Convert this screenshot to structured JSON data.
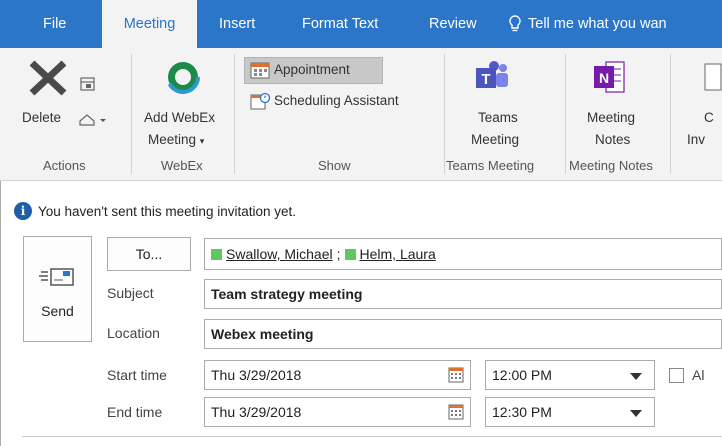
{
  "tabs": {
    "file": "File",
    "meeting": "Meeting",
    "insert": "Insert",
    "format_text": "Format Text",
    "review": "Review",
    "tell_me": "Tell me what you wan"
  },
  "ribbon": {
    "actions": {
      "delete_label": "Delete",
      "group_label": "Actions"
    },
    "webex": {
      "add_webex_line1": "Add WebEx",
      "add_webex_line2": "Meeting",
      "group_label": "WebEx"
    },
    "show": {
      "appointment": "Appointment",
      "scheduling_assistant": "Scheduling Assistant",
      "group_label": "Show"
    },
    "teams": {
      "line1": "Teams",
      "line2": "Meeting",
      "group_label": "Teams Meeting"
    },
    "notes": {
      "line1": "Meeting",
      "line2": "Notes",
      "group_label": "Meeting Notes"
    },
    "cut_off": {
      "line1": "C",
      "line2": "Inv"
    }
  },
  "info_message": "You haven't sent this meeting invitation yet.",
  "send_label": "Send",
  "form": {
    "to_button": "To...",
    "recipients": [
      "Swallow, Michael",
      "Helm, Laura"
    ],
    "recipient_separator": ";",
    "subject_label": "Subject",
    "subject_value": "Team strategy meeting",
    "location_label": "Location",
    "location_value": "Webex meeting",
    "start_label": "Start time",
    "start_date": "Thu 3/29/2018",
    "start_time": "12:00 PM",
    "end_label": "End time",
    "end_date": "Thu 3/29/2018",
    "end_time": "12:30 PM",
    "all_day_label": "Al"
  },
  "colors": {
    "accent": "#2b76c8",
    "ribbon_bg": "#f3f3f3",
    "presence": "#5dc85d",
    "info_icon": "#1f5da8"
  },
  "icons": {
    "delete": "delete-x-icon",
    "ignore": "ignore-icon",
    "webex": "webex-logo-icon",
    "appointment": "appointment-icon",
    "scheduling": "scheduling-assistant-icon",
    "teams": "teams-logo-icon",
    "onenote": "onenote-logo-icon",
    "info": "info-icon",
    "send": "send-icon",
    "calendar": "calendar-icon"
  }
}
